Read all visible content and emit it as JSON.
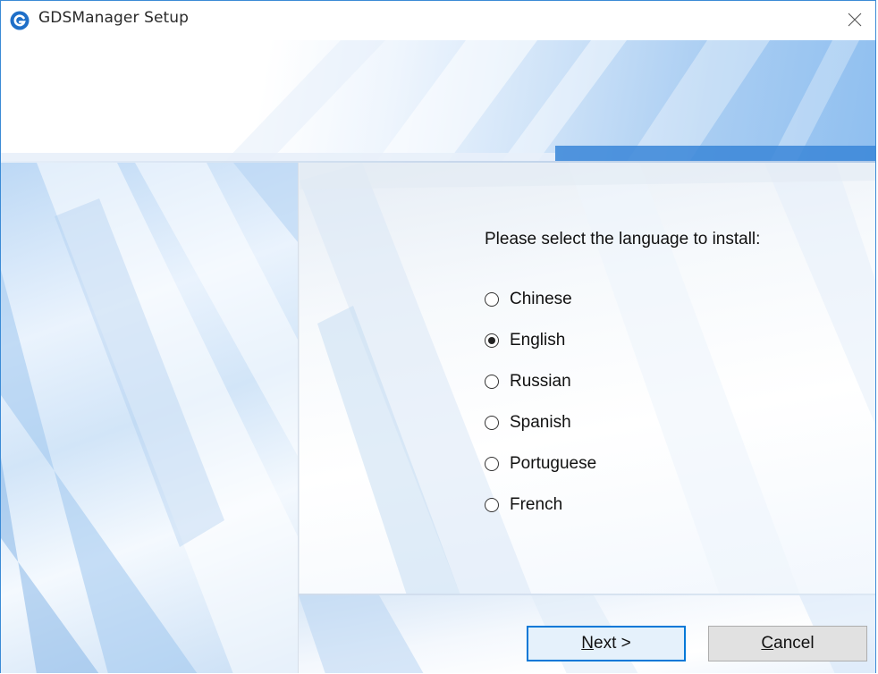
{
  "window": {
    "title": "GDSManager Setup",
    "app_icon": "gds-logo-icon",
    "close_icon": "close-icon"
  },
  "content": {
    "prompt": "Please select the language to install:",
    "languages": [
      {
        "label": "Chinese",
        "selected": false
      },
      {
        "label": "English",
        "selected": true
      },
      {
        "label": "Russian",
        "selected": false
      },
      {
        "label": "Spanish",
        "selected": false
      },
      {
        "label": "Portuguese",
        "selected": false
      },
      {
        "label": "French",
        "selected": false
      }
    ]
  },
  "buttons": {
    "next": {
      "accel": "N",
      "rest": "ext >"
    },
    "cancel": {
      "accel": "C",
      "rest": "ancel"
    }
  },
  "colors": {
    "accent": "#0078d7",
    "window_border": "#3b8bd6"
  }
}
